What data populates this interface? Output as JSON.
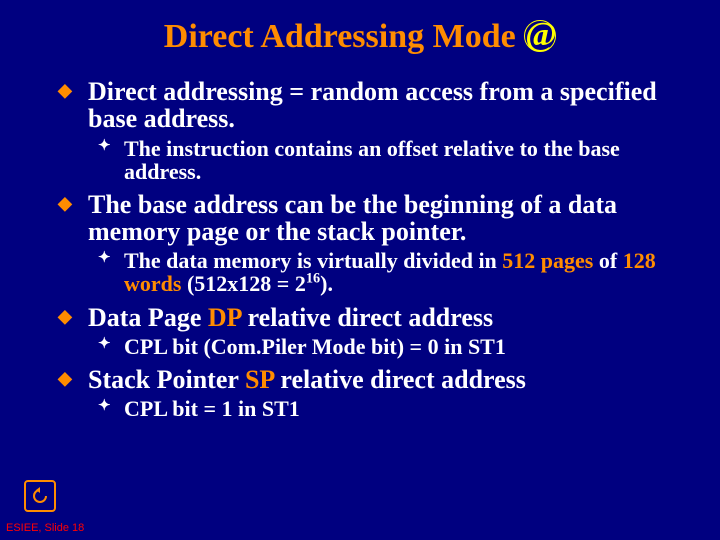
{
  "title": {
    "prefix": "Direct Addressing Mode ",
    "at": "@"
  },
  "bullets": {
    "b1": "Direct addressing = random access from a specified base address.",
    "b1s1": "The instruction contains an offset relative to the base address.",
    "b2": "The base address can be the beginning of a data memory page or the stack pointer.",
    "b2s1_a": "The data memory is virtually divided in ",
    "b2s1_b": "512 pages",
    "b2s1_c": " of ",
    "b2s1_d": "128 words",
    "b2s1_e": " (512x128 = 2",
    "b2s1_f": "16",
    "b2s1_g": ").",
    "b3_a": "Data Page ",
    "b3_b": "DP",
    "b3_c": " relative direct address",
    "b3s1": "CPL bit (Com.Piler Mode bit) = 0 in ST1",
    "b4_a": "Stack Pointer ",
    "b4_b": "SP",
    "b4_c": " relative direct address",
    "b4s1": "CPL bit = 1 in ST1"
  },
  "footer": "ESIEE, Slide 18"
}
